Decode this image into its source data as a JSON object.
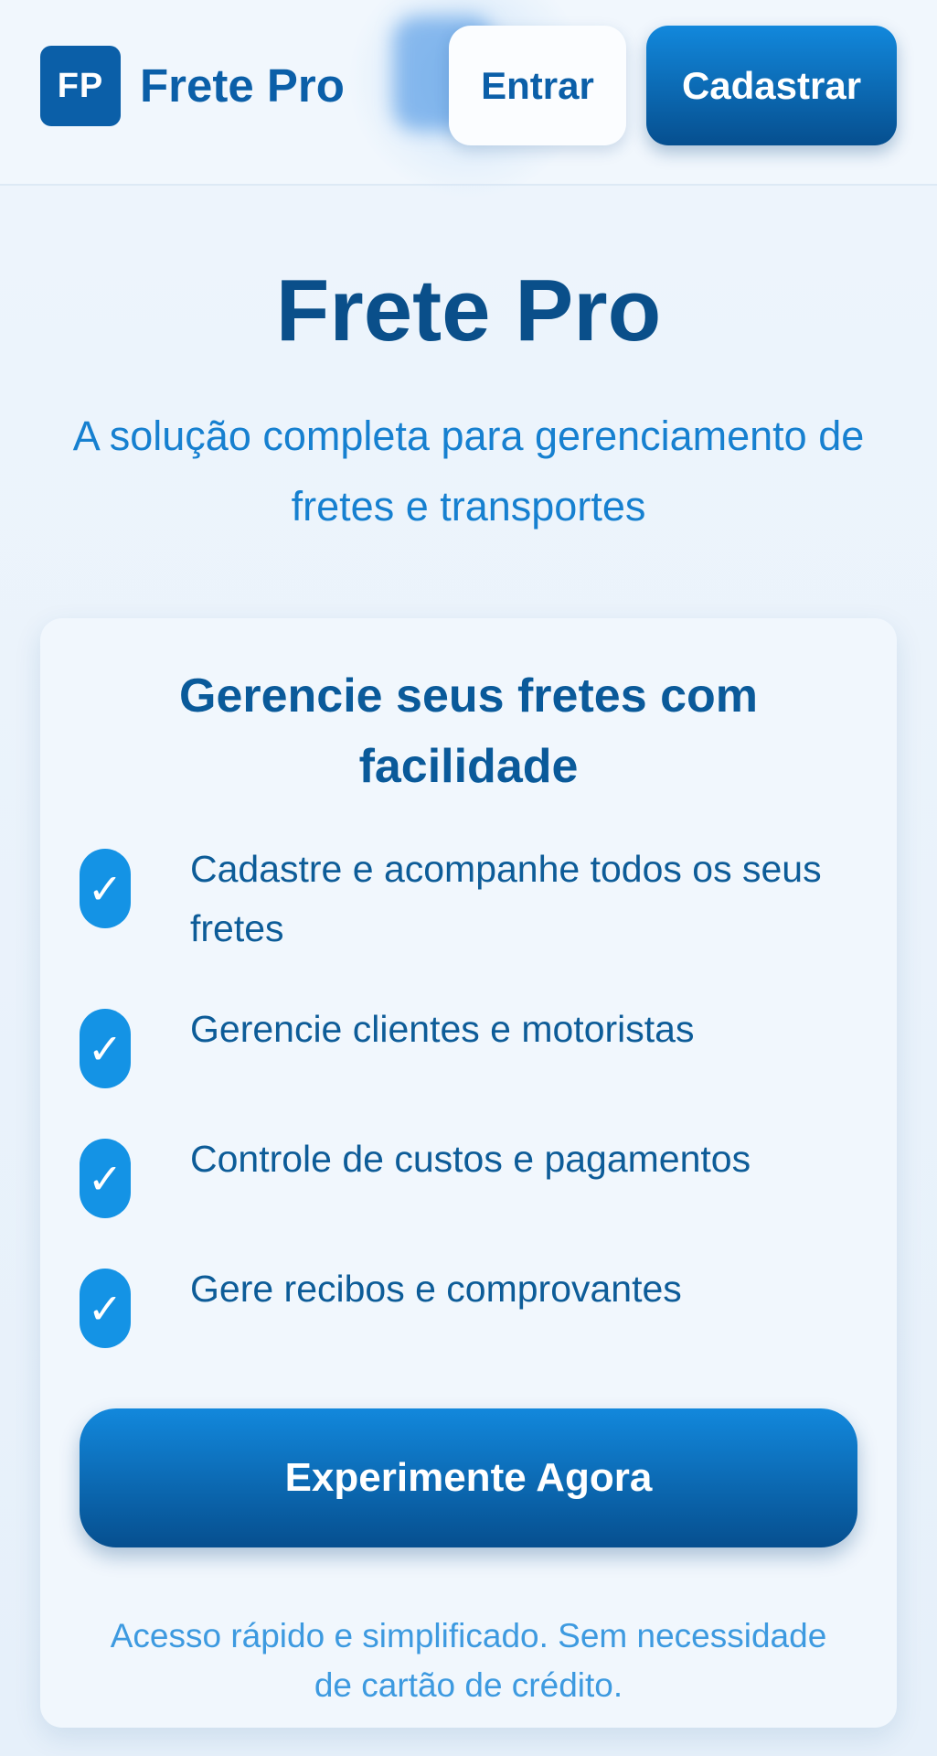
{
  "header": {
    "logo_initials": "FP",
    "brand_name": "Frete Pro",
    "login_label": "Entrar",
    "signup_label": "Cadastrar"
  },
  "hero": {
    "title": "Frete Pro",
    "subtitle": "A solução completa para gerenciamento de fretes e transportes"
  },
  "card": {
    "title": "Gerencie seus fretes com facilidade",
    "features": [
      "Cadastre e acompanhe todos os seus fretes",
      "Gerencie clientes e motoristas",
      "Controle de custos e pagamentos",
      "Gere recibos e comprovantes"
    ],
    "check_glyph": "✓",
    "cta_label": "Experimente Agora",
    "note": "Acesso rápido e simplificado. Sem necessidade de cartão de crédito."
  },
  "colors": {
    "primary": "#0b5fa8",
    "accent": "#1493e5",
    "background": "#eef5fc"
  }
}
